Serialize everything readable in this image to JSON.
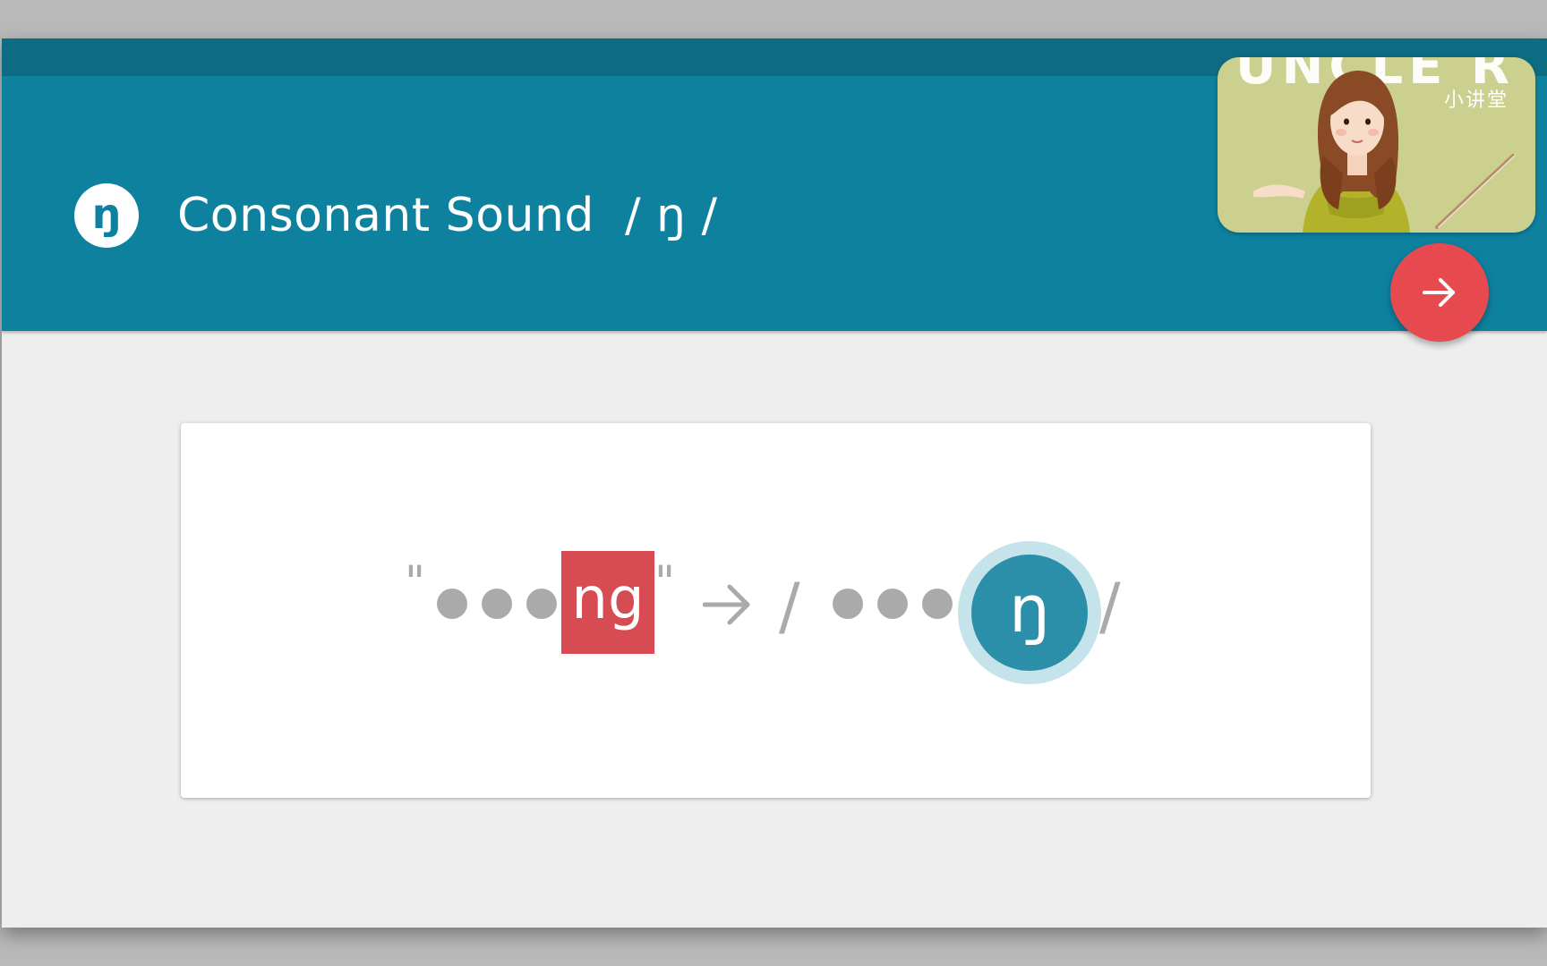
{
  "header": {
    "logo_glyph": "ŋ",
    "title": "Consonant Sound  / ŋ /"
  },
  "video_overlay": {
    "brand_text": "小讲堂",
    "scribble_text": "UNCLE R"
  },
  "navigation": {
    "next_icon": "arrow-right-icon"
  },
  "lesson_card": {
    "open_quote": "\"",
    "highlighted_letters": "ng",
    "close_quote": "\"",
    "arrow": "→",
    "slash_open": "/",
    "phoneme": "ŋ",
    "slash_close": "/",
    "placeholder_dot_count": 3
  },
  "colors": {
    "header_bg": "#0e819f",
    "status_strip": "#0d6b83",
    "accent_red": "#e64a4f",
    "highlight_red": "#d64c52",
    "phoneme_blue": "#2b8fa9",
    "placeholder_gray": "#aaaaaa"
  }
}
